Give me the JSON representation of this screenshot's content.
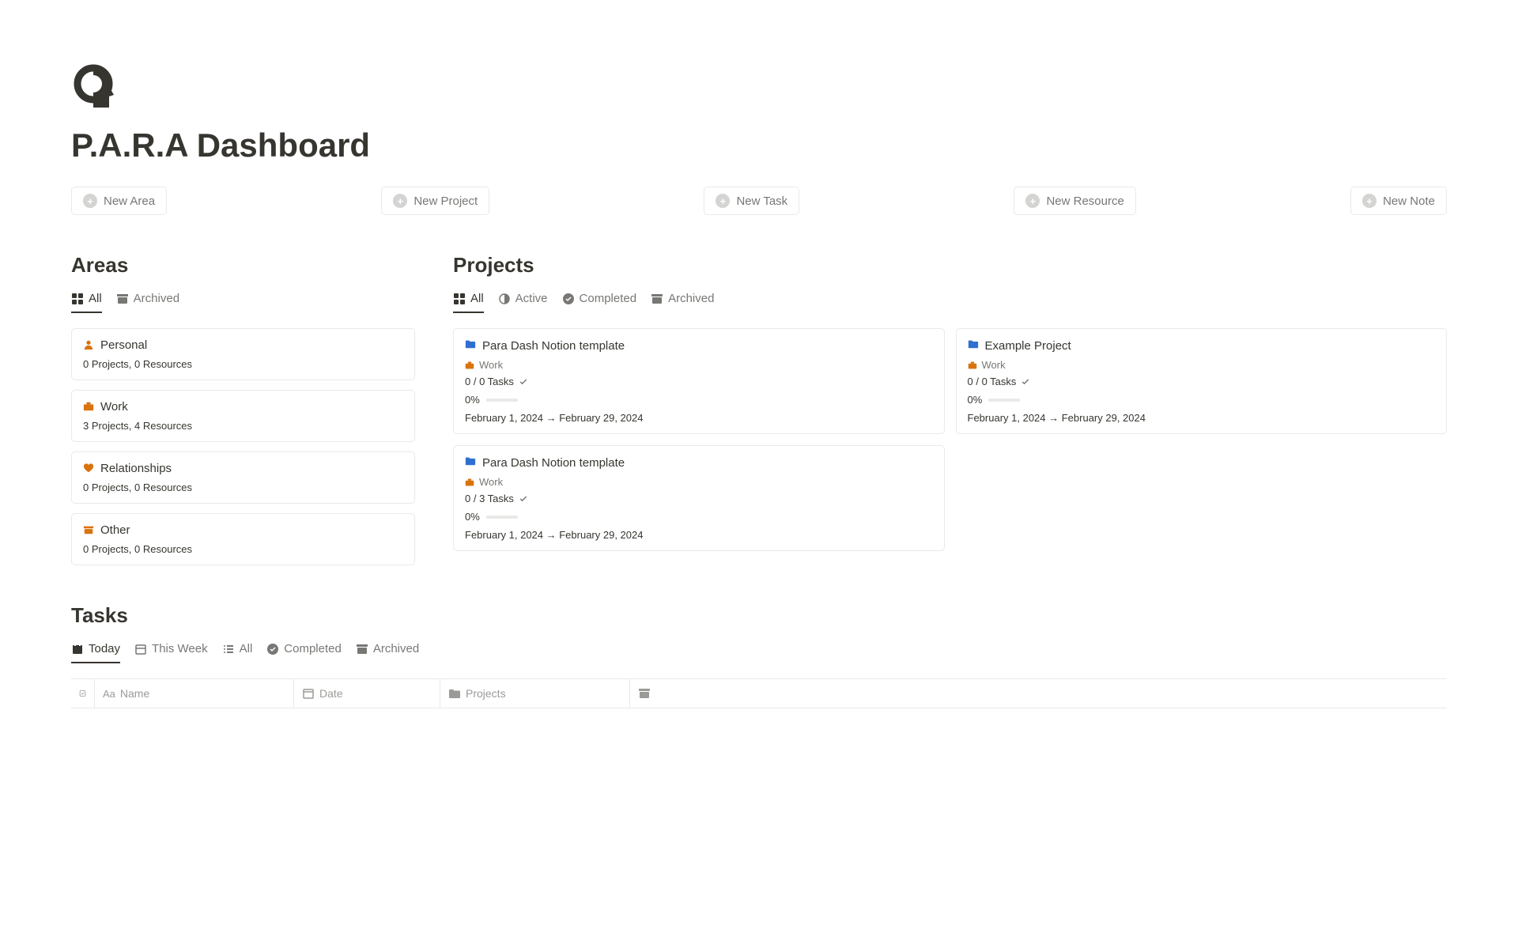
{
  "page": {
    "title": "P.A.R.A Dashboard"
  },
  "actions": {
    "new_area": "New Area",
    "new_project": "New Project",
    "new_task": "New Task",
    "new_resource": "New Resource",
    "new_note": "New Note"
  },
  "areas": {
    "title": "Areas",
    "tabs": {
      "all": "All",
      "archived": "Archived"
    },
    "items": [
      {
        "icon": "person-icon",
        "name": "Personal",
        "meta": "0 Projects, 0 Resources"
      },
      {
        "icon": "briefcase-icon",
        "name": "Work",
        "meta": "3 Projects, 4 Resources"
      },
      {
        "icon": "heart-icon",
        "name": "Relationships",
        "meta": "0 Projects, 0 Resources"
      },
      {
        "icon": "box-icon",
        "name": "Other",
        "meta": "0 Projects, 0 Resources"
      }
    ]
  },
  "projects": {
    "title": "Projects",
    "tabs": {
      "all": "All",
      "active": "Active",
      "completed": "Completed",
      "archived": "Archived"
    },
    "items": [
      {
        "icon": "folder-icon",
        "name": "Para Dash Notion template",
        "area": "Work",
        "tasks": "0 / 0 Tasks",
        "progress": "0%",
        "dates": "February 1, 2024 → February 29, 2024"
      },
      {
        "icon": "folder-icon",
        "name": "Example Project",
        "area": "Work",
        "tasks": "0 / 0 Tasks",
        "progress": "0%",
        "dates": "February 1, 2024 → February 29, 2024"
      },
      {
        "icon": "folder-icon",
        "name": "Para Dash Notion template",
        "area": "Work",
        "tasks": "0 / 3 Tasks",
        "progress": "0%",
        "dates": "February 1, 2024 → February 29, 2024"
      }
    ]
  },
  "tasks": {
    "title": "Tasks",
    "tabs": {
      "today": "Today",
      "this_week": "This Week",
      "all": "All",
      "completed": "Completed",
      "archived": "Archived"
    },
    "columns": {
      "name": "Name",
      "date": "Date",
      "projects": "Projects"
    }
  }
}
